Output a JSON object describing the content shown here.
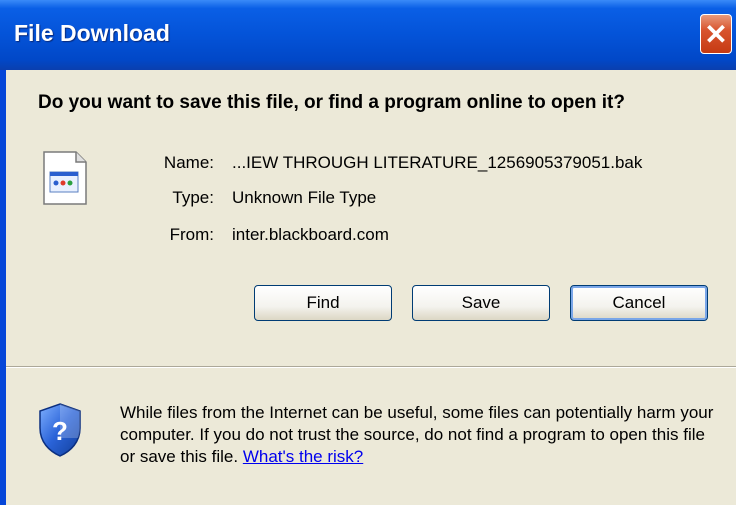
{
  "window": {
    "title": "File Download"
  },
  "dialog": {
    "question": "Do you want to save this file, or find a program online to open it?",
    "file": {
      "name_label": "Name:",
      "name_value": "...IEW THROUGH LITERATURE_1256905379051.bak",
      "type_label": "Type:",
      "type_value": "Unknown File Type",
      "from_label": "From:",
      "from_value": "inter.blackboard.com"
    },
    "buttons": {
      "find": "Find",
      "save": "Save",
      "cancel": "Cancel"
    },
    "warning": {
      "text": "While files from the Internet can be useful, some files can potentially harm your computer. If you do not trust the source, do not find a program to open this file or save this file.",
      "link": "What's the risk?"
    }
  },
  "colors": {
    "titlebar": "#0453d8",
    "dialog_bg": "#ece9d8",
    "close_button": "#d8542e",
    "link": "#0000ee"
  },
  "icons": {
    "close": "close-icon",
    "file": "file-icon",
    "shield": "shield-question-icon"
  }
}
